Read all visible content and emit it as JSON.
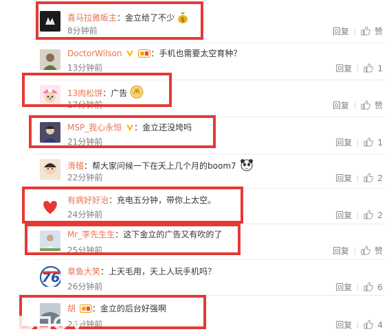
{
  "comments": [
    {
      "name": "喜马拉雅皈主",
      "sep": "：",
      "text": "金立给了不少",
      "time": "8分钟前",
      "reply": "回复",
      "likes": "赞",
      "emoji": "money-bag-icon"
    },
    {
      "name": "DoctorWilson",
      "sep": "：",
      "text": "手机也需要太空育种？",
      "time": "13分钟前",
      "reply": "回复",
      "likes": "1"
    },
    {
      "name": "13肉松饼",
      "sep": "：",
      "text": "广告",
      "time": "17分钟前",
      "reply": "回复",
      "likes": "赞",
      "emoji": "clap-icon"
    },
    {
      "name": "MSP_我心永恒",
      "sep": "：",
      "text": "金立还没垮吗",
      "time": "21分钟前",
      "reply": "回复",
      "likes": "1"
    },
    {
      "name": "滑稽",
      "sep": "：",
      "text": "帮大家问候一下在天上几个月的boom7",
      "time": "22分钟前",
      "reply": "回复",
      "likes": "2"
    },
    {
      "name": "有病好好治",
      "sep": "：",
      "text": "充电五分钟，带你上太空。",
      "time": "24分钟前",
      "reply": "回复",
      "likes": "2"
    },
    {
      "name": "Mr_李先生生",
      "sep": "：",
      "text": "这下金立的广告又有吹的了",
      "time": "25分钟前",
      "reply": "回复",
      "likes": "赞"
    },
    {
      "name": "章鱼大笑",
      "sep": "：",
      "text": "上天毛用，天上人玩手机吗？",
      "time": "26分钟前",
      "reply": "回复",
      "likes": "6"
    },
    {
      "name": "胡",
      "sep": "：",
      "text": "金立的后台好强啊",
      "time": "26分钟前",
      "reply": "回复",
      "likes": "4"
    }
  ],
  "colors": {
    "name": "#eb7350",
    "highlight": "#e53935",
    "muted": "#808080"
  }
}
